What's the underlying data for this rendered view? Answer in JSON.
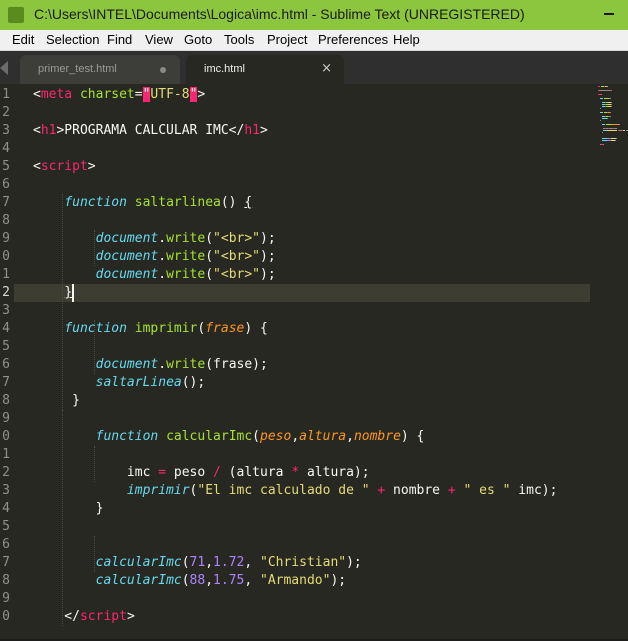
{
  "window": {
    "title": "C:\\Users\\INTEL\\Documents\\Logica\\imc.html - Sublime Text (UNREGISTERED)"
  },
  "menu": [
    "Edit",
    "Selection",
    "Find",
    "View",
    "Goto",
    "Tools",
    "Project",
    "Preferences",
    "Help"
  ],
  "tabs": [
    {
      "label": "primer_test.html",
      "active": false,
      "indicator": "dirty-dot"
    },
    {
      "label": "imc.html",
      "active": true,
      "indicator": "close-icon"
    }
  ],
  "tab_close_glyph": "×",
  "line_numbers": [
    "1",
    "2",
    "3",
    "4",
    "5",
    "6",
    "7",
    "8",
    "9",
    "0",
    "1",
    "2",
    "3",
    "4",
    "5",
    "6",
    "7",
    "8",
    "9",
    "0",
    "1",
    "2",
    "3",
    "4",
    "5",
    "6",
    "7",
    "8",
    "9",
    "0"
  ],
  "current_line_index": 11,
  "code_lines": [
    [
      [
        "t-plain",
        "<"
      ],
      [
        "t-tag",
        "meta"
      ],
      [
        "t-plain",
        " "
      ],
      [
        "t-attr",
        "charset"
      ],
      [
        "t-plain",
        "="
      ],
      [
        "t-attrval-bad",
        "\""
      ],
      [
        "t-str",
        "UTF-8"
      ],
      [
        "t-attrval-bad",
        "\""
      ],
      [
        "t-plain",
        ">"
      ]
    ],
    [],
    [
      [
        "t-plain",
        "<"
      ],
      [
        "t-tag",
        "h1"
      ],
      [
        "t-plain",
        ">PROGRAMA CALCULAR IMC</"
      ],
      [
        "t-tag",
        "h1"
      ],
      [
        "t-plain",
        ">"
      ]
    ],
    [],
    [
      [
        "t-plain",
        "<"
      ],
      [
        "t-tag",
        "script"
      ],
      [
        "t-plain",
        ">"
      ]
    ],
    [],
    [
      [
        "t-plain",
        "    "
      ],
      [
        "t-kw",
        "function"
      ],
      [
        "t-plain",
        " "
      ],
      [
        "t-fn",
        "saltarlinea"
      ],
      [
        "t-plain",
        "() "
      ],
      [
        "t-ul",
        "{"
      ]
    ],
    [],
    [
      [
        "t-plain",
        "        "
      ],
      [
        "t-ident",
        "document"
      ],
      [
        "t-plain",
        "."
      ],
      [
        "t-fn",
        "write"
      ],
      [
        "t-plain",
        "("
      ],
      [
        "t-str",
        "\"<br>\""
      ],
      [
        "t-plain",
        ");"
      ]
    ],
    [
      [
        "t-plain",
        "        "
      ],
      [
        "t-ident",
        "document"
      ],
      [
        "t-plain",
        "."
      ],
      [
        "t-fn",
        "write"
      ],
      [
        "t-plain",
        "("
      ],
      [
        "t-str",
        "\"<br>\""
      ],
      [
        "t-plain",
        ");"
      ]
    ],
    [
      [
        "t-plain",
        "        "
      ],
      [
        "t-ident",
        "document"
      ],
      [
        "t-plain",
        "."
      ],
      [
        "t-fn",
        "write"
      ],
      [
        "t-plain",
        "("
      ],
      [
        "t-str",
        "\"<br>\""
      ],
      [
        "t-plain",
        ");"
      ]
    ],
    [
      [
        "t-plain",
        "    "
      ],
      [
        "t-ul",
        "}"
      ]
    ],
    [],
    [
      [
        "t-plain",
        "    "
      ],
      [
        "t-kw",
        "function"
      ],
      [
        "t-plain",
        " "
      ],
      [
        "t-fn",
        "imprimir"
      ],
      [
        "t-plain",
        "("
      ],
      [
        "t-param",
        "frase"
      ],
      [
        "t-plain",
        ") {"
      ]
    ],
    [],
    [
      [
        "t-plain",
        "        "
      ],
      [
        "t-ident",
        "document"
      ],
      [
        "t-plain",
        "."
      ],
      [
        "t-fn",
        "write"
      ],
      [
        "t-plain",
        "(frase);"
      ]
    ],
    [
      [
        "t-plain",
        "        "
      ],
      [
        "t-ident",
        "saltarLinea"
      ],
      [
        "t-plain",
        "();"
      ]
    ],
    [
      [
        "t-plain",
        "     }"
      ]
    ],
    [],
    [
      [
        "t-plain",
        "        "
      ],
      [
        "t-kw",
        "function"
      ],
      [
        "t-plain",
        " "
      ],
      [
        "t-fn",
        "calcularImc"
      ],
      [
        "t-plain",
        "("
      ],
      [
        "t-param",
        "peso"
      ],
      [
        "t-plain",
        ","
      ],
      [
        "t-param",
        "altura"
      ],
      [
        "t-plain",
        ","
      ],
      [
        "t-param",
        "nombre"
      ],
      [
        "t-plain",
        ") {"
      ]
    ],
    [],
    [
      [
        "t-plain",
        "            imc "
      ],
      [
        "t-op",
        "="
      ],
      [
        "t-plain",
        " peso "
      ],
      [
        "t-op",
        "/"
      ],
      [
        "t-plain",
        " (altura "
      ],
      [
        "t-op",
        "*"
      ],
      [
        "t-plain",
        " altura);"
      ]
    ],
    [
      [
        "t-plain",
        "            "
      ],
      [
        "t-ident",
        "imprimir"
      ],
      [
        "t-plain",
        "("
      ],
      [
        "t-str",
        "\"El imc calculado de \""
      ],
      [
        "t-plain",
        " "
      ],
      [
        "t-op",
        "+"
      ],
      [
        "t-plain",
        " nombre "
      ],
      [
        "t-op",
        "+"
      ],
      [
        "t-plain",
        " "
      ],
      [
        "t-str",
        "\" es \""
      ],
      [
        "t-plain",
        " imc);"
      ]
    ],
    [
      [
        "t-plain",
        "        }"
      ]
    ],
    [],
    [],
    [
      [
        "t-plain",
        "        "
      ],
      [
        "t-ident",
        "calcularImc"
      ],
      [
        "t-plain",
        "("
      ],
      [
        "t-num",
        "71"
      ],
      [
        "t-plain",
        ","
      ],
      [
        "t-num",
        "1.72"
      ],
      [
        "t-plain",
        ", "
      ],
      [
        "t-str",
        "\"Christian\""
      ],
      [
        "t-plain",
        ");"
      ]
    ],
    [
      [
        "t-plain",
        "        "
      ],
      [
        "t-ident",
        "calcularImc"
      ],
      [
        "t-plain",
        "("
      ],
      [
        "t-num",
        "88"
      ],
      [
        "t-plain",
        ","
      ],
      [
        "t-num",
        "1.75"
      ],
      [
        "t-plain",
        ", "
      ],
      [
        "t-str",
        "\"Armando\""
      ],
      [
        "t-plain",
        ");"
      ]
    ],
    [],
    [
      [
        "t-plain",
        "    </"
      ],
      [
        "t-tag",
        "script"
      ],
      [
        "t-plain",
        ">"
      ]
    ]
  ],
  "colors": {
    "titlebar": "#8cc63e",
    "editor_bg": "#272822",
    "keyword": "#66d9ef",
    "tag": "#f92672",
    "string": "#e6db74",
    "function": "#a6e22e",
    "param": "#fd971f",
    "number": "#ae81ff"
  }
}
